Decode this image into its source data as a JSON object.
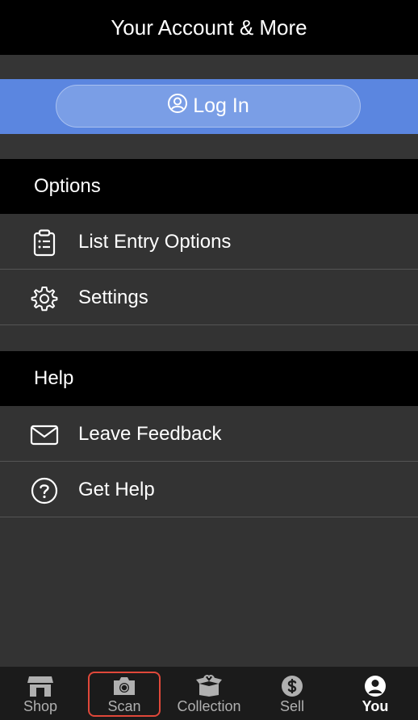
{
  "header": {
    "title": "Your Account & More"
  },
  "login": {
    "label": "Log In",
    "icon": "user-circle-icon"
  },
  "sections": {
    "options": {
      "title": "Options"
    },
    "help": {
      "title": "Help"
    }
  },
  "options_items": [
    {
      "label": "List Entry Options",
      "icon": "clipboard-list-icon"
    },
    {
      "label": "Settings",
      "icon": "gear-icon"
    }
  ],
  "help_items": [
    {
      "label": "Leave Feedback",
      "icon": "envelope-icon"
    },
    {
      "label": "Get Help",
      "icon": "question-circle-icon"
    }
  ],
  "tabbar": {
    "tabs": [
      {
        "label": "Shop",
        "icon": "storefront-icon"
      },
      {
        "label": "Scan",
        "icon": "camera-icon"
      },
      {
        "label": "Collection",
        "icon": "box-icon"
      },
      {
        "label": "Sell",
        "icon": "dollar-circle-icon"
      },
      {
        "label": "You",
        "icon": "user-circle-icon"
      }
    ],
    "active": "You"
  },
  "colors": {
    "login_band": "#5b86e0",
    "header_bg": "#000000",
    "row_bg": "#333333",
    "highlight": "#e0483a"
  }
}
